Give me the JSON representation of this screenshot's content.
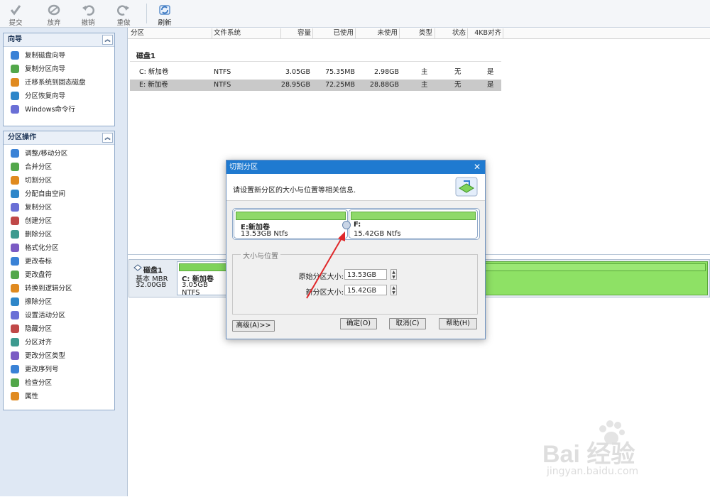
{
  "toolbar": {
    "buttons": [
      {
        "label": "提交"
      },
      {
        "label": "放弃"
      },
      {
        "label": "撤销"
      },
      {
        "label": "重做"
      },
      {
        "label": "刷新"
      }
    ]
  },
  "wizard_panel": {
    "title": "向导",
    "items": [
      {
        "label": "复制磁盘向导",
        "icon": "copy-disk-icon"
      },
      {
        "label": "复制分区向导",
        "icon": "copy-partition-icon"
      },
      {
        "label": "迁移系统到固态磁盘",
        "icon": "migrate-os-icon"
      },
      {
        "label": "分区恢复向导",
        "icon": "recovery-icon"
      },
      {
        "label": "Windows命令行",
        "icon": "cmd-icon"
      }
    ]
  },
  "ops_panel": {
    "title": "分区操作",
    "items": [
      {
        "label": "调整/移动分区"
      },
      {
        "label": "合并分区"
      },
      {
        "label": "切割分区"
      },
      {
        "label": "分配自由空间"
      },
      {
        "label": "复制分区"
      },
      {
        "label": "创建分区"
      },
      {
        "label": "删除分区"
      },
      {
        "label": "格式化分区"
      },
      {
        "label": "更改卷标"
      },
      {
        "label": "更改盘符"
      },
      {
        "label": "转换到逻辑分区"
      },
      {
        "label": "擦除分区"
      },
      {
        "label": "设置活动分区"
      },
      {
        "label": "隐藏分区"
      },
      {
        "label": "分区对齐"
      },
      {
        "label": "更改分区类型"
      },
      {
        "label": "更改序列号"
      },
      {
        "label": "检查分区"
      },
      {
        "label": "属性"
      }
    ]
  },
  "table": {
    "columns": [
      "分区",
      "文件系统",
      "容量",
      "已使用",
      "未使用",
      "类型",
      "状态",
      "4KB对齐"
    ],
    "group": "磁盘1",
    "rows": [
      {
        "partition": "C: 新加卷",
        "fs": "NTFS",
        "capacity": "3.05GB",
        "used": "75.35MB",
        "free": "2.98GB",
        "type": "主",
        "status": "无",
        "align": "是"
      },
      {
        "partition": "E: 新加卷",
        "fs": "NTFS",
        "capacity": "28.95GB",
        "used": "72.25MB",
        "free": "28.88GB",
        "type": "主",
        "status": "无",
        "align": "是"
      }
    ]
  },
  "diskmap": {
    "disk_name": "磁盘1",
    "disk_type": "基本 MBR",
    "disk_size": "32.00GB",
    "c_label": "C: 新加卷",
    "c_info": "3.05GB NTFS"
  },
  "dialog": {
    "title": "切割分区",
    "info": "请设置新分区的大小与位置等相关信息.",
    "left_part_name": "E:新加卷",
    "left_part_info": "13.53GB Ntfs",
    "right_part_name": "F:",
    "right_part_info": "15.42GB Ntfs",
    "group_title": "大小与位置",
    "orig_label": "原始分区大小:",
    "orig_value": "13.53GB",
    "new_label": "新分区大小:",
    "new_value": "15.42GB",
    "advanced_btn": "高级(A)>>",
    "ok_btn": "确定(O)",
    "cancel_btn": "取消(C)",
    "help_btn": "帮助(H)"
  },
  "watermark": {
    "line1": "Bai 经验",
    "line2": "jingyan.baidu.com"
  },
  "colors": {
    "accent": "#1f7ad0",
    "partition_green": "#7fd35a",
    "panel_bg": "#dfe8f4"
  }
}
